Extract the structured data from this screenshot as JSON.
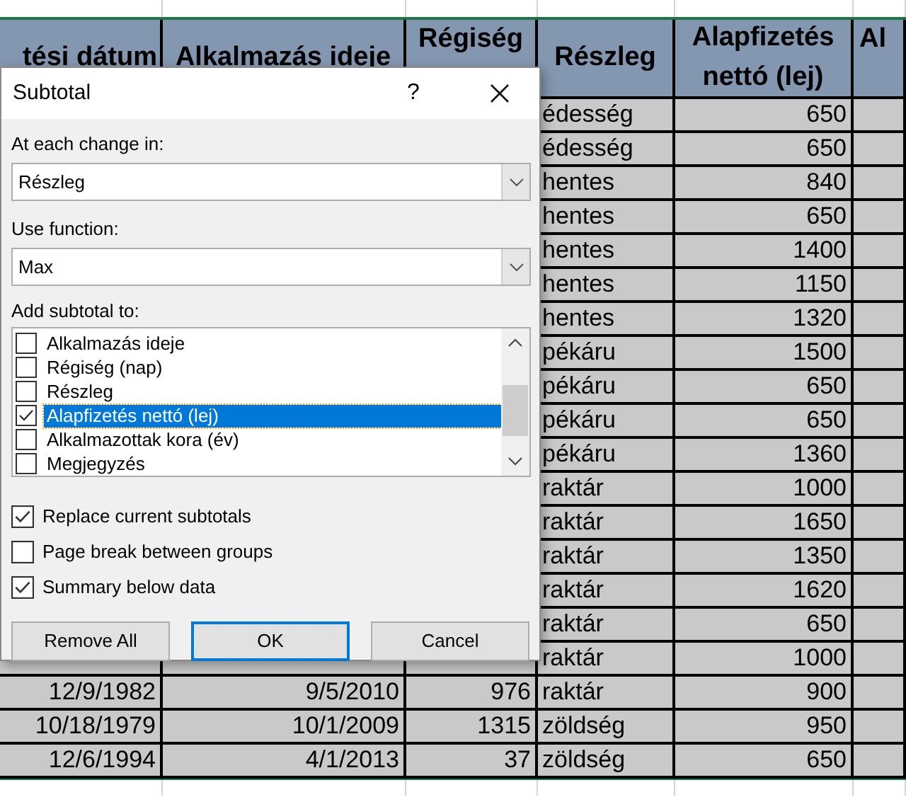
{
  "sheet": {
    "headers": [
      "tési dátum",
      "Alkalmazás ideje",
      "Régiség",
      "Részleg",
      "Alapfizetés nettó (lej)",
      "Al"
    ],
    "rows": [
      {
        "dept": "édesség",
        "salary": "650"
      },
      {
        "dept": "édesség",
        "salary": "650"
      },
      {
        "dept": "hentes",
        "salary": "840"
      },
      {
        "dept": "hentes",
        "salary": "650"
      },
      {
        "dept": "hentes",
        "salary": "1400"
      },
      {
        "dept": "hentes",
        "salary": "1150"
      },
      {
        "dept": "hentes",
        "salary": "1320"
      },
      {
        "dept": "pékáru",
        "salary": "1500"
      },
      {
        "dept": "pékáru",
        "salary": "650"
      },
      {
        "dept": "pékáru",
        "salary": "650"
      },
      {
        "dept": "pékáru",
        "salary": "1360"
      },
      {
        "dept": "raktár",
        "salary": "1000"
      },
      {
        "dept": "raktár",
        "salary": "1650"
      },
      {
        "dept": "raktár",
        "salary": "1350"
      },
      {
        "dept": "raktár",
        "salary": "1620"
      },
      {
        "dept": "raktár",
        "salary": "650"
      },
      {
        "dept": "raktár",
        "salary": "1000"
      },
      {
        "birth": "12/9/1982",
        "hired": "9/5/2010",
        "age": "976",
        "dept": "raktár",
        "salary": "900"
      },
      {
        "birth": "10/18/1979",
        "hired": "10/1/2009",
        "age": "1315",
        "dept": "zöldség",
        "salary": "950"
      },
      {
        "birth": "12/6/1994",
        "hired": "4/1/2013",
        "age": "37",
        "dept": "zöldség",
        "salary": "650"
      }
    ]
  },
  "dialog": {
    "title": "Subtotal",
    "help": "?",
    "change_label": "At each change in:",
    "change_value": "Részleg",
    "function_label": "Use function:",
    "function_value": "Max",
    "add_label": "Add subtotal to:",
    "fields": [
      {
        "label": "Alkalmazás ideje",
        "checked": false,
        "selected": false
      },
      {
        "label": "Régiség (nap)",
        "checked": false,
        "selected": false
      },
      {
        "label": "Részleg",
        "checked": false,
        "selected": false
      },
      {
        "label": "Alapfizetés nettó (lej)",
        "checked": true,
        "selected": true
      },
      {
        "label": "Alkalmazottak kora (év)",
        "checked": false,
        "selected": false
      },
      {
        "label": "Megjegyzés",
        "checked": false,
        "selected": false
      }
    ],
    "options": [
      {
        "label": "Replace current subtotals",
        "checked": true
      },
      {
        "label": "Page break between groups",
        "checked": false
      },
      {
        "label": "Summary below data",
        "checked": true
      }
    ],
    "buttons": [
      {
        "label": "Remove All",
        "default": false
      },
      {
        "label": "OK",
        "default": true
      },
      {
        "label": "Cancel",
        "default": false
      }
    ]
  }
}
